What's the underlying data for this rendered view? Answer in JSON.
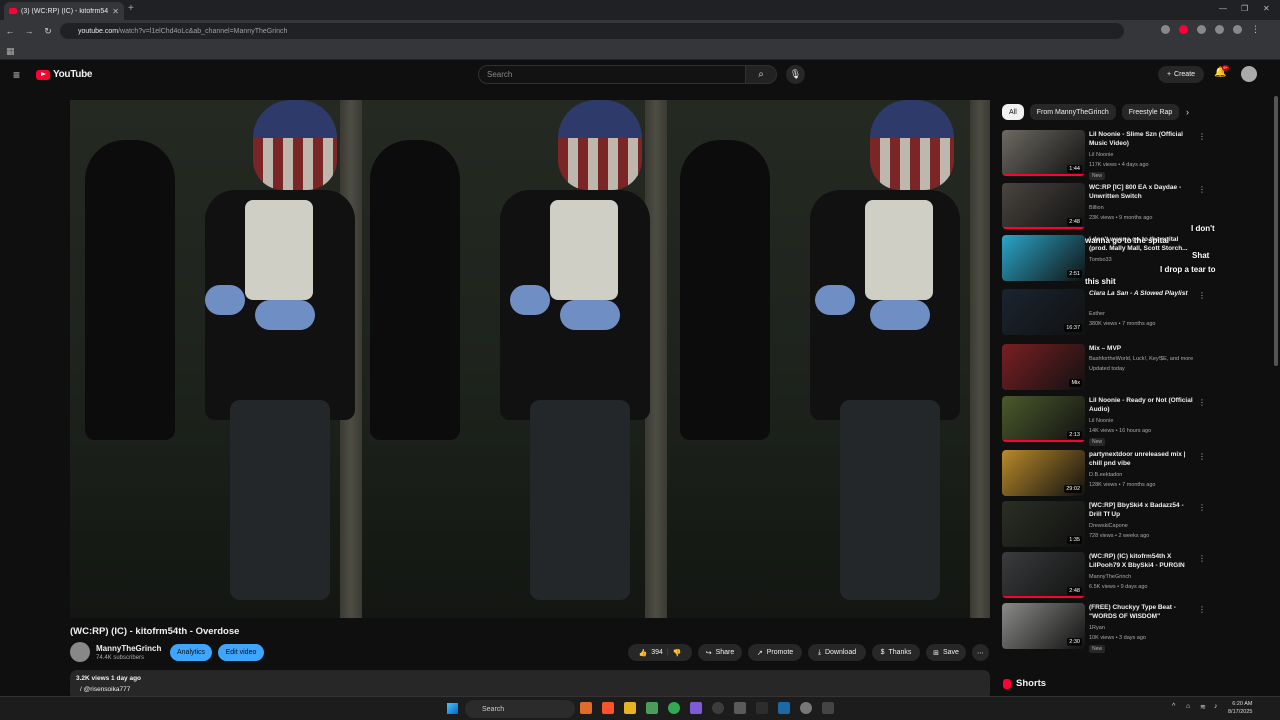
{
  "browser": {
    "tab_title": "(3) (WC:RP) (IC) - kitofrm54",
    "url_prefix": "youtube.com",
    "url_rest": "/watch?v=l1elChd4oLc&ab_channel=MannyTheGrinch"
  },
  "header": {
    "logo_text": "YouTube",
    "search_placeholder": "Search",
    "create_label": "Create",
    "notif_count": "9+"
  },
  "video": {
    "title": "(WC:RP) (IC) - kitofrm54th - Overdose",
    "channel": "MannyTheGrinch",
    "subscribers": "74.4K subscribers",
    "analytics_label": "Analytics",
    "edit_label": "Edit video",
    "likes": "394",
    "share_label": "Share",
    "promote_label": "Promote",
    "download_label": "Download",
    "thanks_label": "Thanks",
    "save_label": "Save",
    "views_line": "3.2K views  1 day ago",
    "hashtag": "/ @risensoika777"
  },
  "chips": [
    "All",
    "From MannyTheGrinch",
    "Freestyle Rap"
  ],
  "recommendations": [
    {
      "title": "Lil Noonie - Slime Szn (Official Music Video)",
      "channel": "Lil Noonie",
      "meta": "117K views • 4 days ago",
      "duration": "1:44",
      "new": "New",
      "thumb": "#6d6a63"
    },
    {
      "title": "WC:RP [IC] 800 EA x Daydae - Unwritten Switch",
      "channel": "Billion",
      "meta": "23K views • 9 months ago",
      "duration": "2:48",
      "new": "",
      "thumb": "#4a4540"
    },
    {
      "title": "I don't wanna go to the spital (prod. Mally Mall, Scott Storch...",
      "channel": "Tombo33",
      "meta": "",
      "duration": "2:51",
      "new": "",
      "thumb": "#2aa6c9"
    },
    {
      "title": "Clara La San - A Slowed Playlist",
      "channel": "Esther",
      "meta": "380K views • 7 months ago",
      "duration": "16:37",
      "new": "",
      "thumb": "#1a2430"
    },
    {
      "title": "Mix – MVP",
      "channel": "BashfortheWorld, Luck!, Key!$E, and more",
      "meta": "Updated today",
      "duration": "Mix",
      "new": "",
      "thumb": "#7a1f22"
    },
    {
      "title": "Lil Noonie - Ready or Not (Official Audio)",
      "channel": "Lil Noonie",
      "meta": "14K views • 16 hours ago",
      "duration": "2:13",
      "new": "New",
      "thumb": "#4b5a2c"
    },
    {
      "title": "partynextdoor unreleased mix | chill pnd vibe",
      "channel": "D.B.eektadon",
      "meta": "128K views • 7 months ago",
      "duration": "29:02",
      "new": "",
      "thumb": "#b98a2a"
    },
    {
      "title": "[WC:RP] BbySki4 x Badazz54 - Drill Tf Up",
      "channel": "DrewskiCapone",
      "meta": "728 views • 2 weeks ago",
      "duration": "1:35",
      "new": "",
      "thumb": "#2a2f24"
    },
    {
      "title": "(WC:RP) (IC) kitofrm54th X LilPooh79 X BbySki4 - PURGIN",
      "channel": "MannyTheGrinch",
      "meta": "6.5K views • 9 days ago",
      "duration": "2:48",
      "new": "",
      "thumb": "#3a3c3d"
    },
    {
      "title": "(FREE) Chuckyy Type Beat - \"WORDS OF WISDOM\"",
      "channel": "1Ryan",
      "meta": "10K views • 3 days ago",
      "duration": "2:30",
      "new": "New",
      "thumb": "#8a8a88"
    }
  ],
  "overlay_lyrics": [
    "I don't",
    "wanna go to the spital",
    "Shat",
    "I drop a tear to",
    "this shit"
  ],
  "shorts_label": "Shorts",
  "taskbar": {
    "search_label": "Search",
    "time": "6:20 AM",
    "date": "8/17/2025"
  },
  "colors": {
    "accent": "#ff0033",
    "blue_button": "#3ea6ff"
  }
}
